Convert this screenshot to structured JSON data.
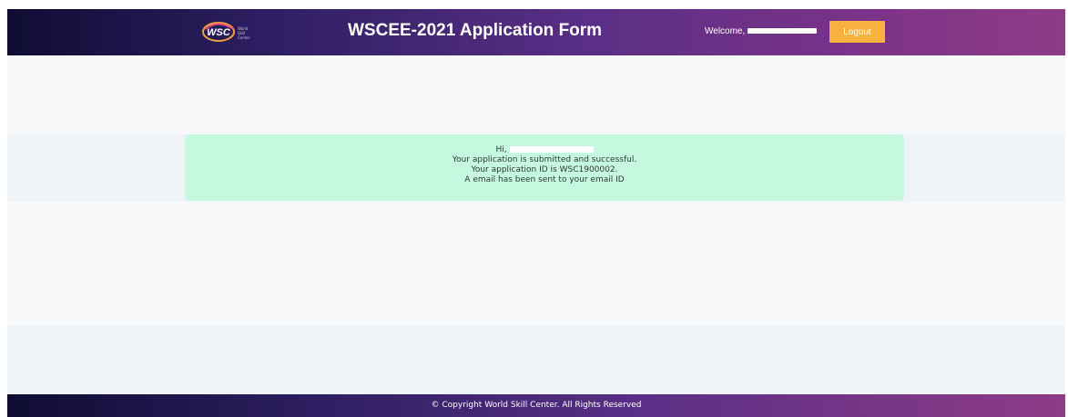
{
  "header": {
    "logo_text": "WSC",
    "logo_subtext": "World Skill Center",
    "title": "WSCEE-2021 Application Form",
    "welcome_label": "Welcome,",
    "logout_label": "Logout"
  },
  "alert": {
    "greeting": "Hi,",
    "line2": "Your application is submitted and successful.",
    "line3": "Your application ID is WSC1900002.",
    "line4": "A email has been sent to your email ID"
  },
  "footer": {
    "copyright": "© Copyright World Skill Center. All Rights Reserved"
  },
  "colors": {
    "header_gradient_start": "#0f0c33",
    "header_gradient_end": "#8e3b86",
    "logout_button": "#f9b13f",
    "alert_background": "#c6f7df"
  }
}
